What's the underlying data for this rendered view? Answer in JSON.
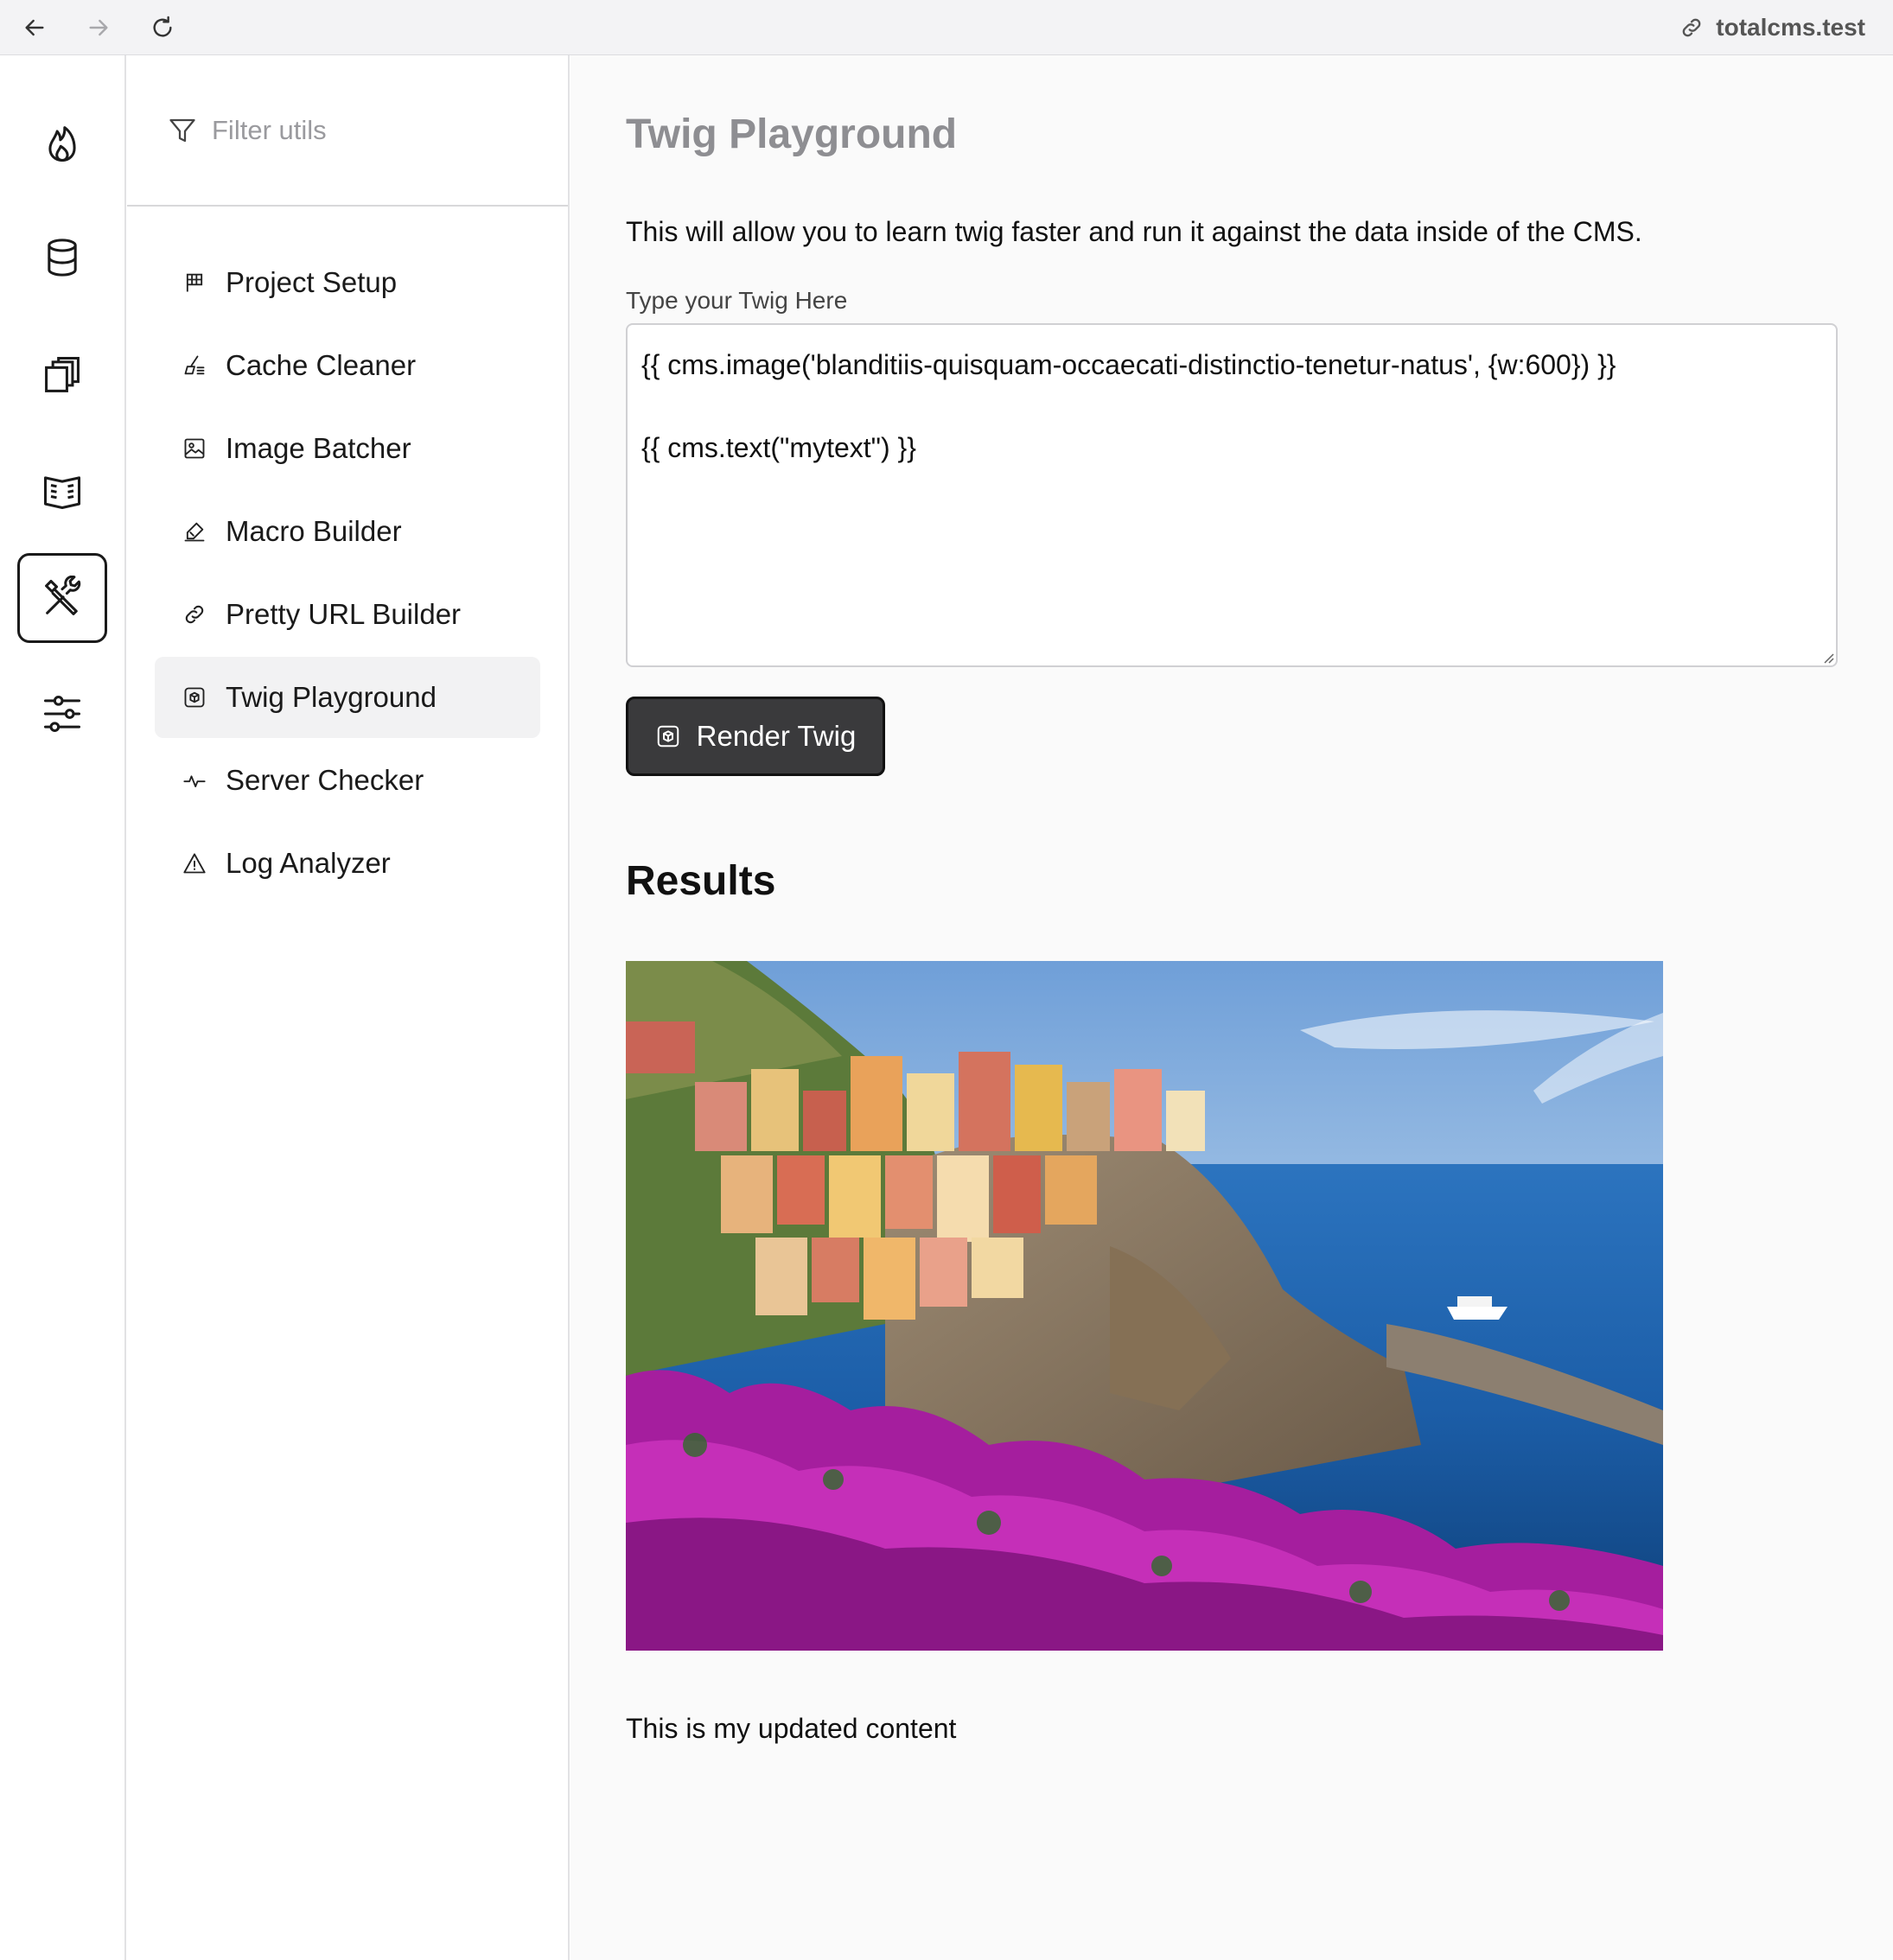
{
  "browser": {
    "url": "totalcms.test"
  },
  "rail": {
    "items": [
      {
        "icon": "flame-icon"
      },
      {
        "icon": "database-icon"
      },
      {
        "icon": "copy-icon"
      },
      {
        "icon": "book-icon"
      },
      {
        "icon": "tools-icon",
        "active": true
      },
      {
        "icon": "sliders-icon"
      }
    ]
  },
  "utils": {
    "filter_placeholder": "Filter utils",
    "items": [
      {
        "label": "Project Setup",
        "icon": "flag-icon"
      },
      {
        "label": "Cache Cleaner",
        "icon": "broom-icon"
      },
      {
        "label": "Image Batcher",
        "icon": "image-icon"
      },
      {
        "label": "Macro Builder",
        "icon": "pencil-ruler-icon"
      },
      {
        "label": "Pretty URL Builder",
        "icon": "link-icon"
      },
      {
        "label": "Twig Playground",
        "icon": "package-icon",
        "active": true
      },
      {
        "label": "Server Checker",
        "icon": "pulse-icon"
      },
      {
        "label": "Log Analyzer",
        "icon": "warning-icon"
      }
    ]
  },
  "main": {
    "title": "Twig Playground",
    "description": "This will allow you to learn twig faster and run it against the data inside of the CMS.",
    "editor_label": "Type your Twig Here",
    "editor_lines": [
      "{{ cms.image('blanditiis-quisquam-occaecati-distinctio-tenetur-natus', {w:600}) }}",
      "",
      "{{ cms.text(\"mytext\") }}"
    ],
    "render_button": "Render Twig",
    "results_heading": "Results",
    "result_text": "This is my updated content"
  }
}
